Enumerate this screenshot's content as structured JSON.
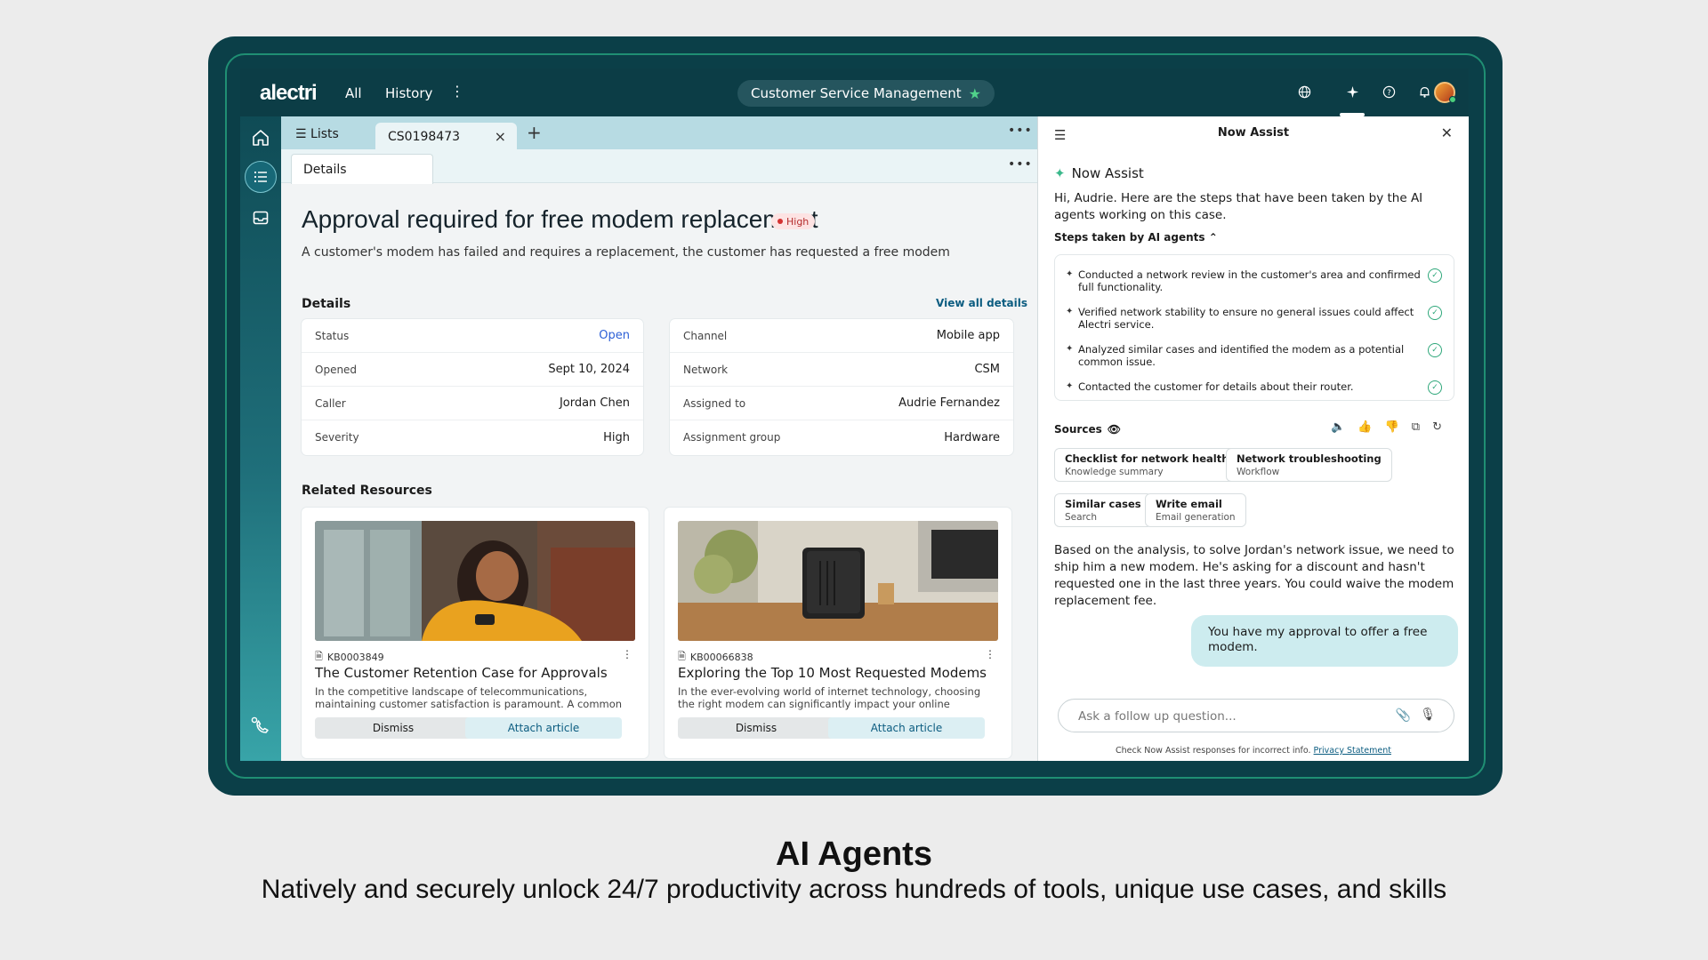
{
  "topbar": {
    "logo": "alectri",
    "nav_all": "All",
    "nav_history": "History",
    "app_pill": "Customer Service Management",
    "icons": [
      "globe-icon",
      "sparkle-icon",
      "help-icon",
      "bell-icon"
    ]
  },
  "tabs": {
    "lists": "Lists",
    "case": "CS0198473",
    "subtab": "Details"
  },
  "case": {
    "title": "Approval required for free modem replacement",
    "priority": "High",
    "description": "A customer's modem has failed and requires a replacement, the customer has requested a free modem"
  },
  "details": {
    "heading": "Details",
    "view_all": "View all details",
    "left": [
      {
        "k": "Status",
        "v": "Open"
      },
      {
        "k": "Opened",
        "v": "Sept 10, 2024"
      },
      {
        "k": "Caller",
        "v": "Jordan Chen"
      },
      {
        "k": "Severity",
        "v": "High"
      }
    ],
    "right": [
      {
        "k": "Channel",
        "v": "Mobile app"
      },
      {
        "k": "Network",
        "v": "CSM"
      },
      {
        "k": "Assigned to",
        "v": "Audrie Fernandez"
      },
      {
        "k": "Assignment group",
        "v": "Hardware"
      }
    ]
  },
  "resources": {
    "heading": "Related Resources",
    "items": [
      {
        "kb": "KB0003849",
        "title": "The Customer Retention Case for Approvals",
        "body": "In the competitive landscape of telecommunications, maintaining customer satisfaction is paramount. A common scenario that Cu...",
        "dismiss": "Dismiss",
        "attach": "Attach article"
      },
      {
        "kb": "KB00066838",
        "title": "Exploring the Top 10 Most Requested Modems",
        "body": "In the ever-evolving world of internet technology, choosing the right modem can significantly impact your online experience. W...",
        "dismiss": "Dismiss",
        "attach": "Attach article"
      }
    ]
  },
  "assist": {
    "panel_title": "Now Assist",
    "brand": "Now Assist",
    "greeting": "Hi, Audrie. Here are the steps that have been taken by the AI agents working on this case.",
    "steps_heading": "Steps taken by AI agents",
    "steps": [
      "Conducted a network review in the customer's area and confirmed full functionality.",
      "Verified network stability to ensure no general issues could affect Alectri service.",
      "Analyzed similar cases and identified the modem as a potential common issue.",
      "Contacted the customer for details about their router."
    ],
    "sources_heading": "Sources",
    "sources": [
      {
        "title": "Checklist for network health",
        "sub": "Knowledge summary"
      },
      {
        "title": "Network troubleshooting",
        "sub": "Workflow"
      },
      {
        "title": "Similar cases",
        "sub": "Search"
      },
      {
        "title": "Write email",
        "sub": "Email generation"
      }
    ],
    "analysis": "Based on the analysis, to solve Jordan's network issue, we need to ship him a new modem. He's asking for a discount and hasn't requested one in the last three years. You could waive the modem replacement fee.",
    "user_message": "You have my approval to offer a free modem.",
    "input_placeholder": "Ask a follow up question...",
    "disclaimer": "Check Now Assist responses for incorrect info.",
    "privacy_link": "Privacy Statement"
  },
  "caption": {
    "title": "AI Agents",
    "subtitle": "Natively and securely unlock 24/7 productivity across hundreds of tools, unique use cases, and skills"
  }
}
